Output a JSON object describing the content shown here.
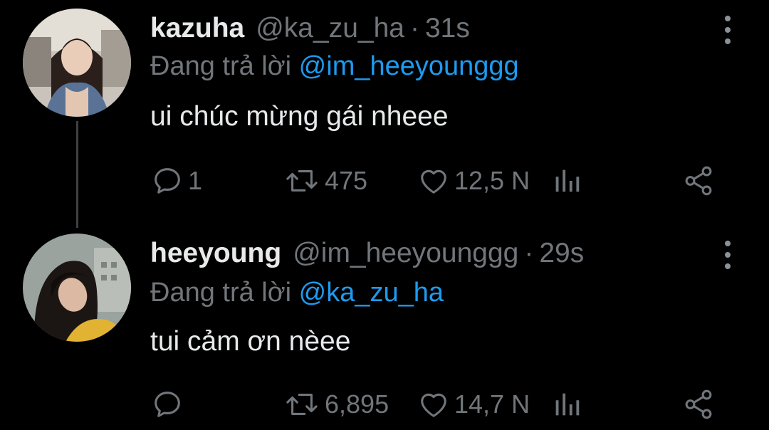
{
  "tweets": [
    {
      "display_name": "kazuha",
      "handle": "@ka_zu_ha",
      "separator": "·",
      "time": "31s",
      "reply_prefix": "Đang trả lời",
      "reply_to": "@im_heeyounggg",
      "text": "ui chúc mừng gái nheee",
      "replies": "1",
      "retweets": "475",
      "likes": "12,5 N",
      "icons": {
        "reply": "speech-bubble-icon",
        "retweet": "retweet-arrows-icon",
        "like": "heart-icon",
        "views": "bar-chart-icon",
        "share": "share-nodes-icon",
        "more": "vertical-ellipsis-icon"
      }
    },
    {
      "display_name": "heeyoung",
      "handle": "@im_heeyounggg",
      "separator": "·",
      "time": "29s",
      "reply_prefix": "Đang trả lời",
      "reply_to": "@ka_zu_ha",
      "text": "tui cảm ơn nèee",
      "replies": "",
      "retweets": "6,895",
      "likes": "14,7 N",
      "icons": {
        "reply": "speech-bubble-icon",
        "retweet": "retweet-arrows-icon",
        "like": "heart-icon",
        "views": "bar-chart-icon",
        "share": "share-nodes-icon",
        "more": "vertical-ellipsis-icon"
      }
    }
  ],
  "colors": {
    "background": "#000000",
    "text_primary": "#e7e9ea",
    "text_secondary": "#71767b",
    "link_accent": "#1d9bf0",
    "thread_line": "#3e4144"
  }
}
